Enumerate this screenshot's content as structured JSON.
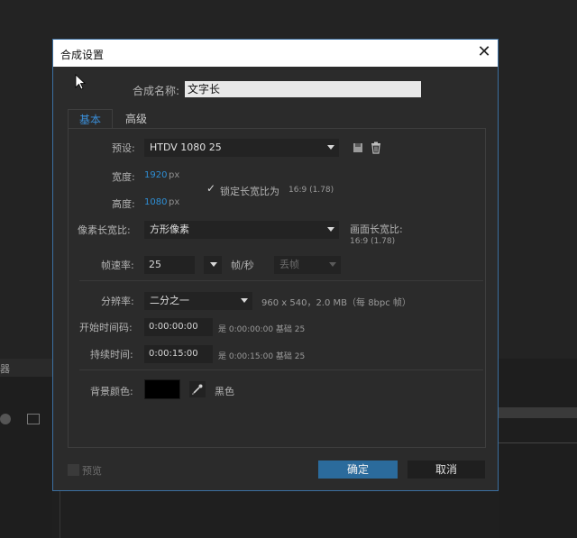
{
  "dialog": {
    "title": "合成设置",
    "close_glyph": "✕",
    "name_label": "合成名称:",
    "name_value": "文字长",
    "tabs": [
      {
        "label": "基本",
        "active": true
      },
      {
        "label": "高级",
        "active": false
      }
    ],
    "preset": {
      "label": "预设:",
      "value": "HTDV 1080 25"
    },
    "width": {
      "label": "宽度:",
      "value": "1920",
      "unit": "px"
    },
    "height": {
      "label": "高度:",
      "value": "1080",
      "unit": "px"
    },
    "lock_aspect": {
      "check": "✓",
      "label": "锁定长宽比为",
      "ratio": "16:9 (1.78)"
    },
    "pixel_aspect": {
      "label": "像素长宽比:",
      "value": "方形像素"
    },
    "frame_aspect": {
      "label": "画面长宽比:",
      "value": "16:9 (1.78)"
    },
    "frame_rate": {
      "label": "帧速率:",
      "value": "25",
      "unit": "帧/秒",
      "drop_frame": "丢帧"
    },
    "resolution": {
      "label": "分辨率:",
      "value": "二分之一",
      "info": "960 x 540，2.0 MB（每 8bpc 帧）"
    },
    "start_timecode": {
      "label": "开始时间码:",
      "value": "0:00:00:00",
      "info": "是 0:00:00:00  基础 25"
    },
    "duration": {
      "label": "持续时间:",
      "value": "0:00:15:00",
      "info": "是 0:00:15:00  基础 25"
    },
    "bg_color": {
      "label": "背景颜色:",
      "color": "#000000",
      "name": "黑色"
    },
    "preview_label": "预览",
    "ok_label": "确定",
    "cancel_label": "取消"
  },
  "background": {
    "panel_label": "器"
  },
  "colors": {
    "accent": "#2e8fd6",
    "ok_button": "#2b6b9c",
    "dialog_border": "#3c6fa0"
  }
}
